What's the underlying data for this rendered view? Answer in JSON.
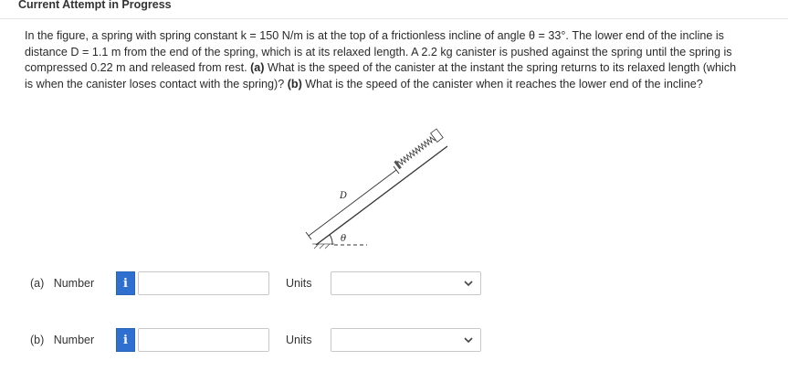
{
  "header": {
    "title": "Current Attempt in Progress"
  },
  "question": {
    "p1": "In the figure, a spring with spring constant k = 150 N/m is at the top of a frictionless incline of angle θ = 33°. The lower end of the incline is distance D = 1.1 m from the end of the spring, which is at its relaxed length. A 2.2 kg canister is pushed against the spring until the spring is compressed 0.22 m and released from rest.",
    "part_a_tag": "(a)",
    "part_a_text": "What is the speed of the canister at the instant the spring returns to its relaxed length (which is when the canister loses contact with the spring)?",
    "part_b_tag": "(b)",
    "part_b_text": "What is the speed of the canister when it reaches the lower end of the incline?"
  },
  "figure": {
    "label_d": "D",
    "label_theta": "θ"
  },
  "answers": [
    {
      "part": "(a)",
      "label": "Number",
      "info": "i",
      "value": "",
      "units_label": "Units",
      "units_value": ""
    },
    {
      "part": "(b)",
      "label": "Number",
      "info": "i",
      "value": "",
      "units_label": "Units",
      "units_value": ""
    }
  ],
  "colors": {
    "info_button": "#2f6fcf",
    "border": "#c8c8c8",
    "text": "#2a2a2a"
  }
}
